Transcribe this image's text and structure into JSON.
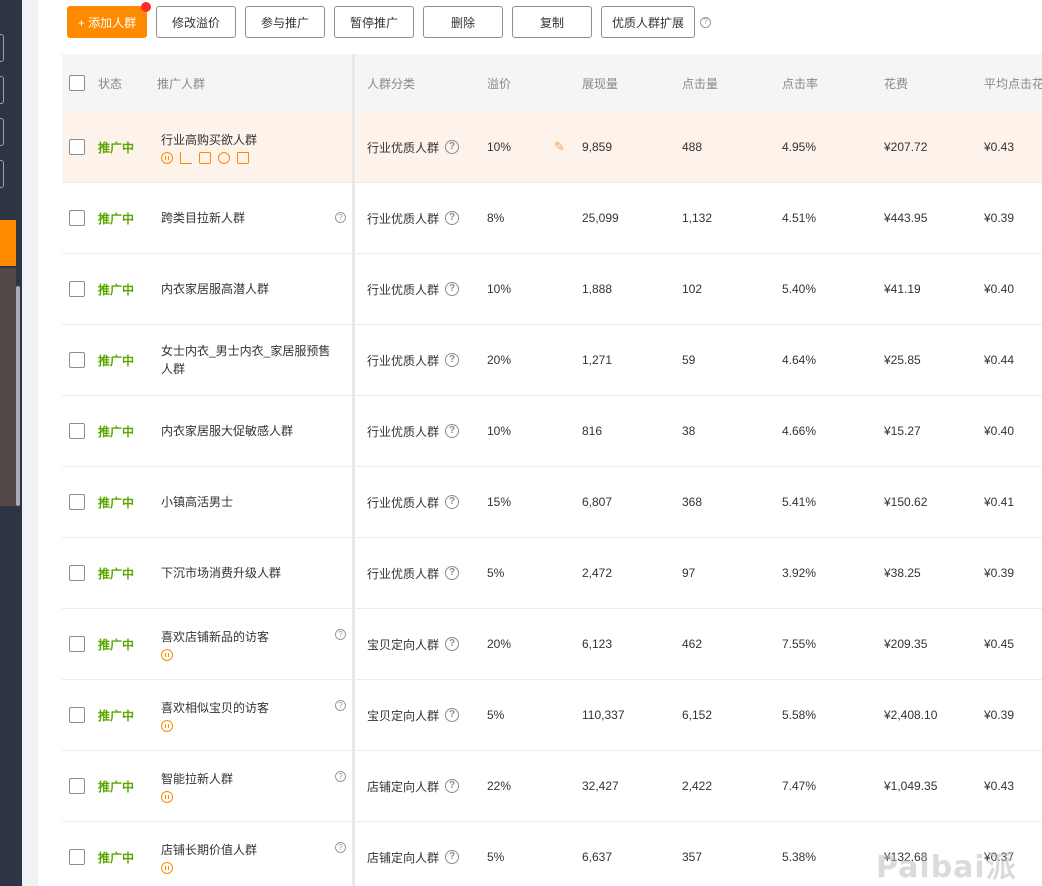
{
  "toolbar": {
    "add_label": "+ 添加人群",
    "modify_premium": "修改溢价",
    "join_promotion": "参与推广",
    "pause_promotion": "暂停推广",
    "delete": "删除",
    "copy": "复制",
    "quality_expand": "优质人群扩展",
    "accent_color": "#ff8a00"
  },
  "table": {
    "headers": {
      "status": "状态",
      "name": "推广人群",
      "category": "人群分类",
      "premium": "溢价",
      "impressions": "展现量",
      "clicks": "点击量",
      "ctr": "点击率",
      "cost": "花费",
      "cpc": "平均点击花"
    },
    "rows": [
      {
        "status": "推广中",
        "name": "行业高购买欲人群",
        "category": "行业优质人群",
        "premium": "10%",
        "impressions": "9,859",
        "clicks": "488",
        "ctr": "4.95%",
        "cost": "¥207.72",
        "cpc": "¥0.43"
      },
      {
        "status": "推广中",
        "name": "跨类目拉新人群",
        "category": "行业优质人群",
        "premium": "8%",
        "impressions": "25,099",
        "clicks": "1,132",
        "ctr": "4.51%",
        "cost": "¥443.95",
        "cpc": "¥0.39"
      },
      {
        "status": "推广中",
        "name": "内衣家居服高潜人群",
        "category": "行业优质人群",
        "premium": "10%",
        "impressions": "1,888",
        "clicks": "102",
        "ctr": "5.40%",
        "cost": "¥41.19",
        "cpc": "¥0.40"
      },
      {
        "status": "推广中",
        "name": "女士内衣_男士内衣_家居服预售人群",
        "category": "行业优质人群",
        "premium": "20%",
        "impressions": "1,271",
        "clicks": "59",
        "ctr": "4.64%",
        "cost": "¥25.85",
        "cpc": "¥0.44"
      },
      {
        "status": "推广中",
        "name": "内衣家居服大促敏感人群",
        "category": "行业优质人群",
        "premium": "10%",
        "impressions": "816",
        "clicks": "38",
        "ctr": "4.66%",
        "cost": "¥15.27",
        "cpc": "¥0.40"
      },
      {
        "status": "推广中",
        "name": "小镇高活男士",
        "category": "行业优质人群",
        "premium": "15%",
        "impressions": "6,807",
        "clicks": "368",
        "ctr": "5.41%",
        "cost": "¥150.62",
        "cpc": "¥0.41"
      },
      {
        "status": "推广中",
        "name": "下沉市场消费升级人群",
        "category": "行业优质人群",
        "premium": "5%",
        "impressions": "2,472",
        "clicks": "97",
        "ctr": "3.92%",
        "cost": "¥38.25",
        "cpc": "¥0.39"
      },
      {
        "status": "推广中",
        "name": "喜欢店铺新品的访客",
        "category": "宝贝定向人群",
        "premium": "20%",
        "impressions": "6,123",
        "clicks": "462",
        "ctr": "7.55%",
        "cost": "¥209.35",
        "cpc": "¥0.45"
      },
      {
        "status": "推广中",
        "name": "喜欢相似宝贝的访客",
        "category": "宝贝定向人群",
        "premium": "5%",
        "impressions": "110,337",
        "clicks": "6,152",
        "ctr": "5.58%",
        "cost": "¥2,408.10",
        "cpc": "¥0.39"
      },
      {
        "status": "推广中",
        "name": "智能拉新人群",
        "category": "店铺定向人群",
        "premium": "22%",
        "impressions": "32,427",
        "clicks": "2,422",
        "ctr": "7.47%",
        "cost": "¥1,049.35",
        "cpc": "¥0.43"
      },
      {
        "status": "推广中",
        "name": "店铺长期价值人群",
        "category": "店铺定向人群",
        "premium": "5%",
        "impressions": "6,637",
        "clicks": "357",
        "ctr": "5.38%",
        "cost": "¥132.68",
        "cpc": "¥0.37"
      }
    ]
  },
  "watermark": "Paibai派代"
}
